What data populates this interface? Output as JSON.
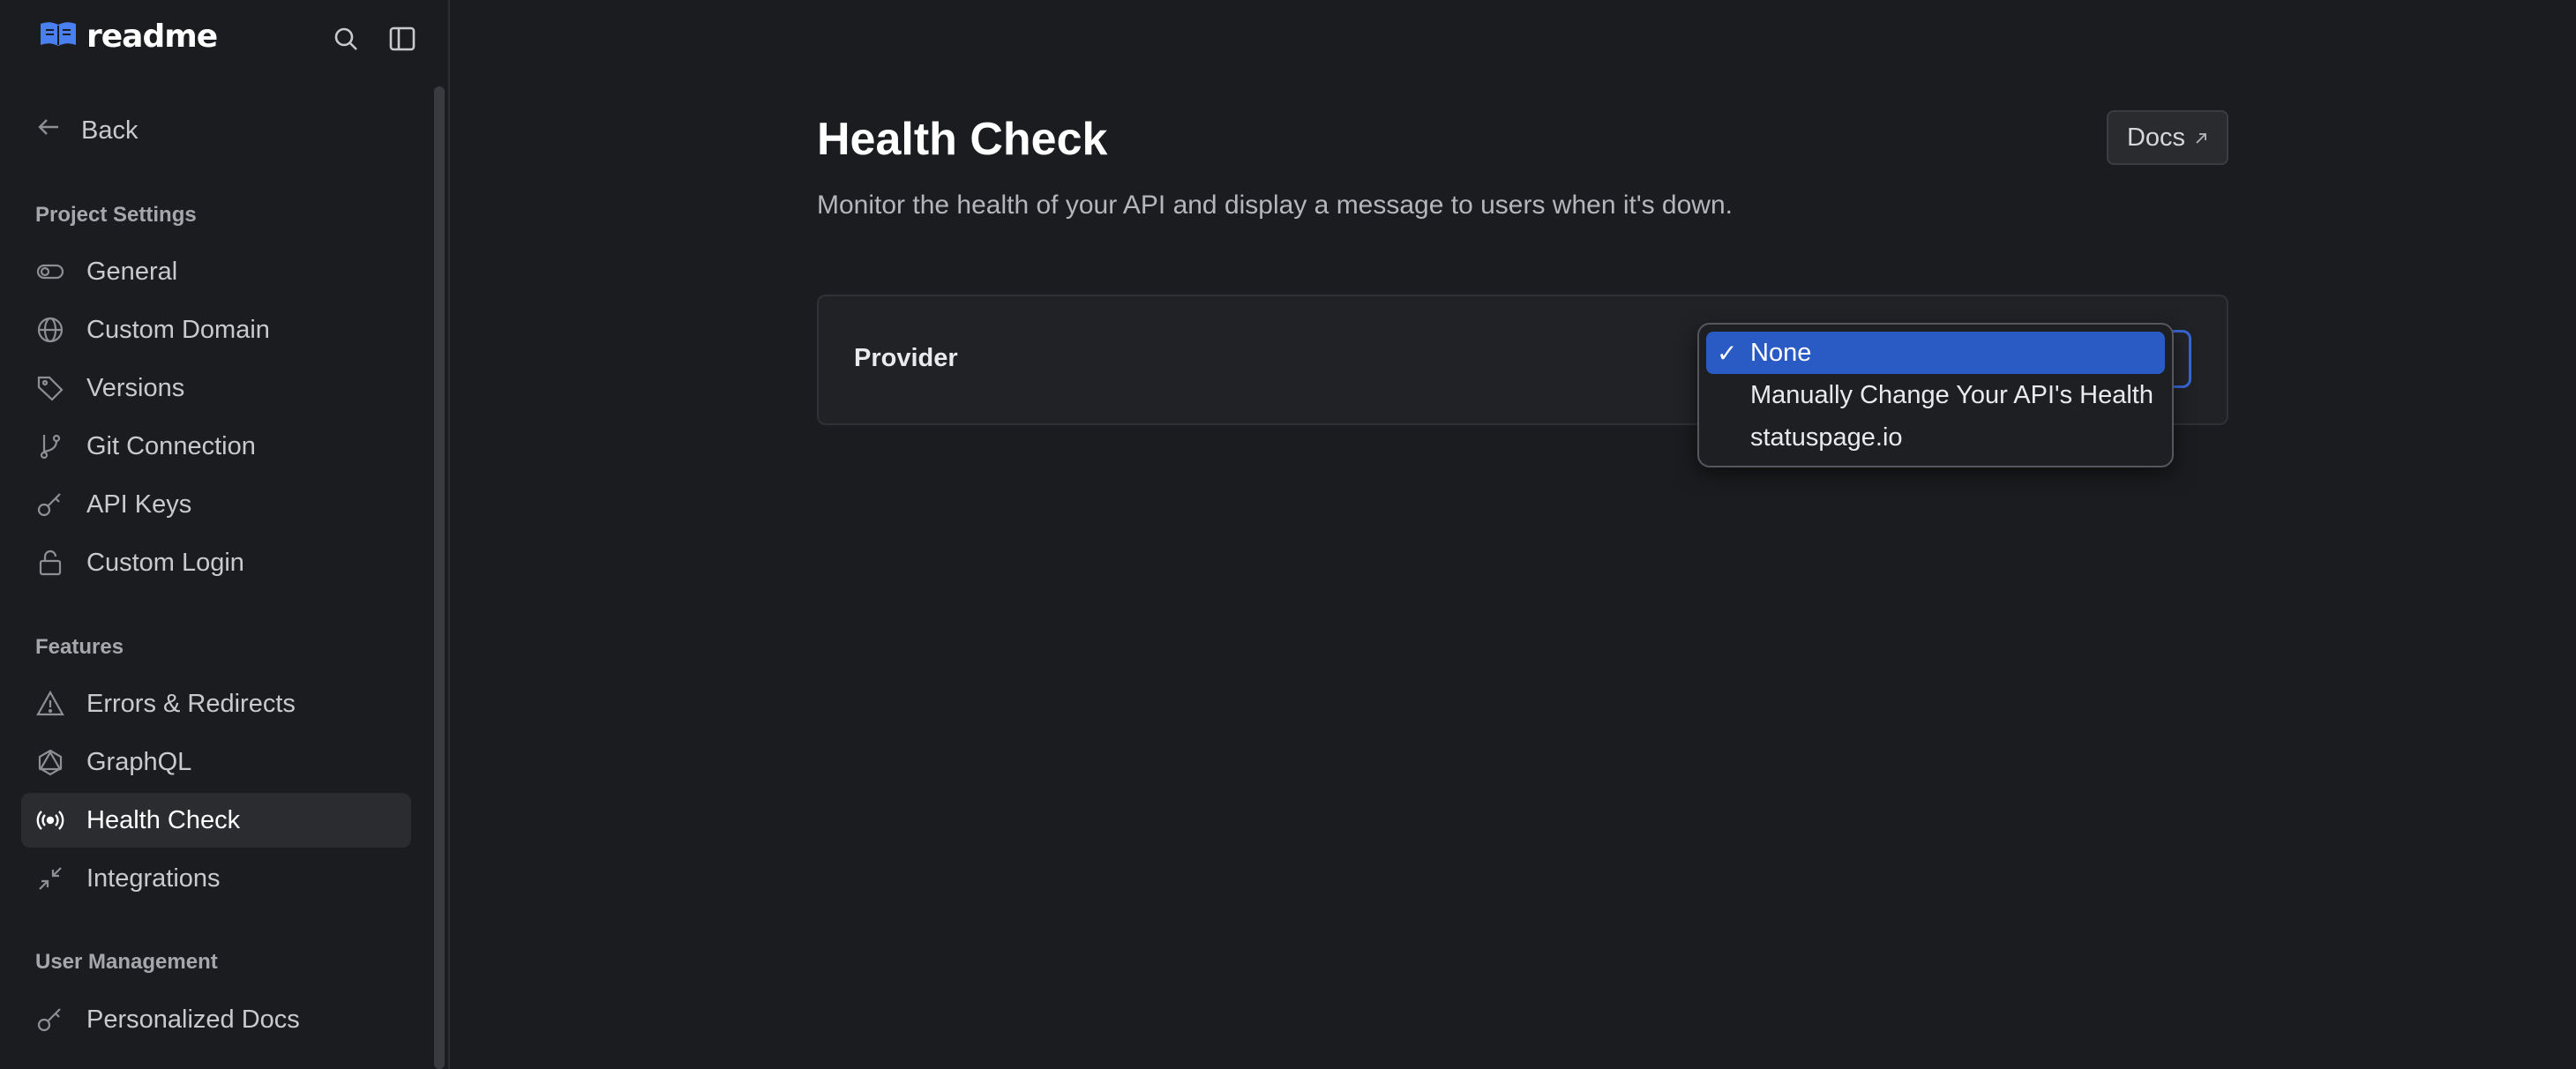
{
  "app": {
    "logo_text": "readme"
  },
  "sidebar": {
    "back_label": "Back",
    "sections": [
      {
        "title": "Project Settings"
      },
      {
        "title": "Features"
      },
      {
        "title": "User Management"
      }
    ],
    "items": [
      {
        "label": "General",
        "icon": "toggle-icon"
      },
      {
        "label": "Custom Domain",
        "icon": "globe-icon"
      },
      {
        "label": "Versions",
        "icon": "tag-icon"
      },
      {
        "label": "Git Connection",
        "icon": "git-branch-icon"
      },
      {
        "label": "API Keys",
        "icon": "key-icon"
      },
      {
        "label": "Custom Login",
        "icon": "lock-icon"
      },
      {
        "label": "Errors & Redirects",
        "icon": "warning-icon"
      },
      {
        "label": "GraphQL",
        "icon": "graphql-icon"
      },
      {
        "label": "Health Check",
        "icon": "broadcast-icon",
        "active": true
      },
      {
        "label": "Integrations",
        "icon": "collapse-arrows-icon"
      },
      {
        "label": "Personalized Docs",
        "icon": "key-icon"
      }
    ]
  },
  "main": {
    "title": "Health Check",
    "description": "Monitor the health of your API and display a message to users when it's down.",
    "docs_button": "Docs",
    "provider_label": "Provider",
    "provider_options": [
      "None",
      "Manually Change Your API's Health",
      "statuspage.io"
    ],
    "provider_selected": "None",
    "check_mark": "✓"
  },
  "colors": {
    "accent": "#2a5bc4",
    "background": "#1b1c1f",
    "logo_blue": "#4a7ff0"
  }
}
